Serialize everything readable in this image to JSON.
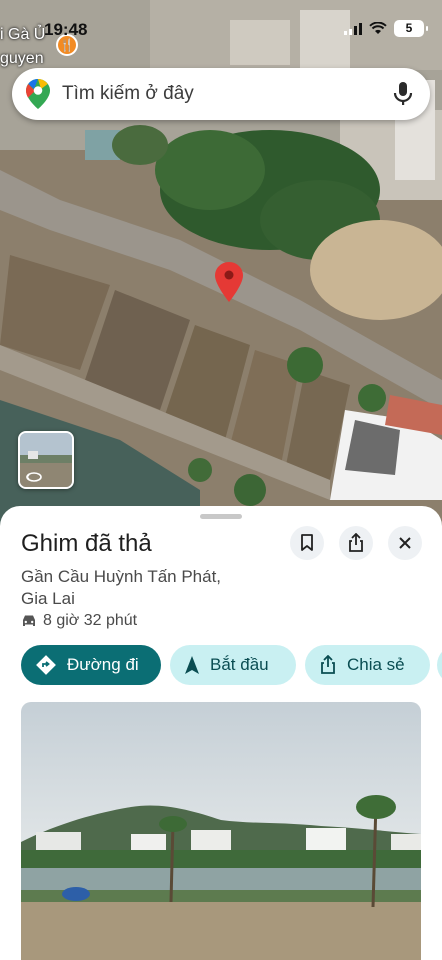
{
  "status_bar": {
    "time": "19:48",
    "battery": "5",
    "map_label_top": "i Gà Ủ",
    "map_label_bottom": "guyen"
  },
  "search": {
    "placeholder": "Tìm kiếm ở đây",
    "logo_icon": "google-maps-pin-icon",
    "mic_icon": "microphone-icon"
  },
  "place": {
    "title": "Ghim đã thả",
    "address_line1": "Gần Cầu Huỳnh Tấn Phát,",
    "address_line2": "Gia Lai",
    "drive_time": "8 giờ 32 phút"
  },
  "actions": {
    "directions_label": "Đường đi",
    "start_label": "Bắt đầu",
    "share_label": "Chia sẻ"
  },
  "colors": {
    "primary": "#0b6e74",
    "secondary": "#c9f0f2",
    "pin": "#e53935"
  }
}
